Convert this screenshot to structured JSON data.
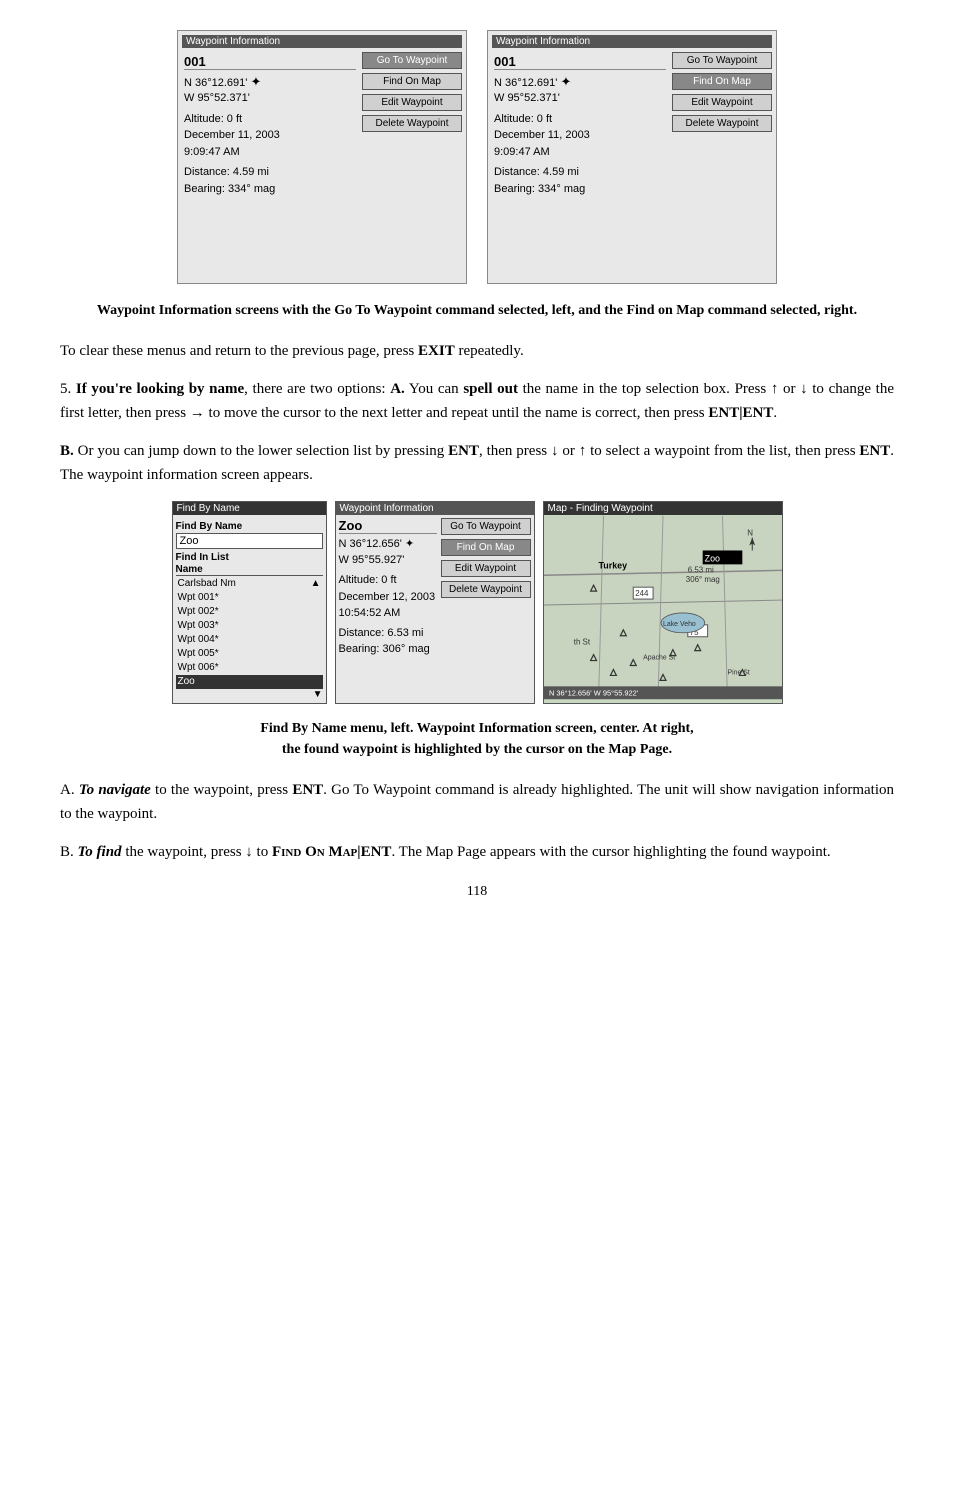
{
  "top_screens": {
    "screen1": {
      "title": "Waypoint Information",
      "id": "001",
      "lat": "N  36°12.691'",
      "lon": "W  95°52.371'",
      "altitude": "Altitude: 0 ft",
      "date": "December 11, 2003",
      "time": "9:09:47 AM",
      "distance": "Distance:   4.59 mi",
      "bearing": "Bearing:     334° mag",
      "buttons": [
        "Go To Waypoint",
        "Find On Map",
        "Edit Waypoint",
        "Delete Waypoint"
      ],
      "highlighted_btn": "Go To Waypoint"
    },
    "screen2": {
      "title": "Waypoint Information",
      "id": "001",
      "lat": "N  36°12.691'",
      "lon": "W  95°52.371'",
      "altitude": "Altitude: 0 ft",
      "date": "December 11, 2003",
      "time": "9:09:47 AM",
      "distance": "Distance:   4.59 mi",
      "bearing": "Bearing:     334° mag",
      "buttons": [
        "Go To Waypoint",
        "Find On Map",
        "Edit Waypoint",
        "Delete Waypoint"
      ],
      "highlighted_btn": "Find On Map"
    }
  },
  "caption1": "Waypoint Information screens with the Go To Waypoint command selected, left, and the Find on Map command selected, right.",
  "para1": "To clear these menus and return to the previous page, press EXIT repeatedly.",
  "para2_prefix": "5. ",
  "para2": "If you're looking by name, there are two options: A. You can spell out the name in the top selection box. Press ↑ or ↓ to change the first letter, then press → to move the cursor to the next letter and repeat until the name is correct, then press ENT|ENT.",
  "para3_label": "B.",
  "para3": "Or you can jump down to the lower selection list by pressing ENT, then press ↓ or ↑ to select a waypoint from the list, then press ENT. The waypoint information screen appears.",
  "find_by_name": {
    "title": "Find By Name",
    "section1_label": "Find By Name",
    "input_value": "Zoo",
    "section2_label": "Find In List",
    "list_header": "Name",
    "list_items": [
      "Carlsbad Nm",
      "Wpt 001*",
      "Wpt 002*",
      "Wpt 003*",
      "Wpt 004*",
      "Wpt 005*",
      "Wpt 006*",
      "Zoo"
    ],
    "highlighted_item": "Zoo"
  },
  "wp_center": {
    "title": "Waypoint Information",
    "id": "Zoo",
    "lat": "N  36°12.656'",
    "lon": "W  95°55.927'",
    "altitude": "Altitude: 0 ft",
    "date": "December 12, 2003",
    "time": "10:54:52 AM",
    "distance": "Distance:   6.53 mi",
    "bearing": "Bearing:     306° mag",
    "buttons": [
      "Go To Waypoint",
      "Find On Map",
      "Edit Waypoint",
      "Delete Waypoint"
    ],
    "highlighted_btn": "Find On Map"
  },
  "map_panel": {
    "title": "Map - Finding Waypoint",
    "labels": [
      "Turkey",
      "Zoo",
      "6.53 mi",
      "306° mag",
      "Lake Veho",
      "Apache St",
      "Pine St"
    ],
    "coords_bottom": "N  36°12.656'  W  95°55.922'"
  },
  "caption2_line1": "Find By Name menu, left. Waypoint Information screen, center. At right,",
  "caption2_line2": "the found waypoint is highlighted by the cursor on the Map Page.",
  "para_a": "A. To navigate to the waypoint, press ENT. Go To Waypoint command is already highlighted. The unit will show navigation information to the waypoint.",
  "para_b": "B. To find the waypoint, press ↓ to FIND ON MAP|ENT. The Map Page appears with the cursor highlighting the found waypoint.",
  "page_number": "118"
}
